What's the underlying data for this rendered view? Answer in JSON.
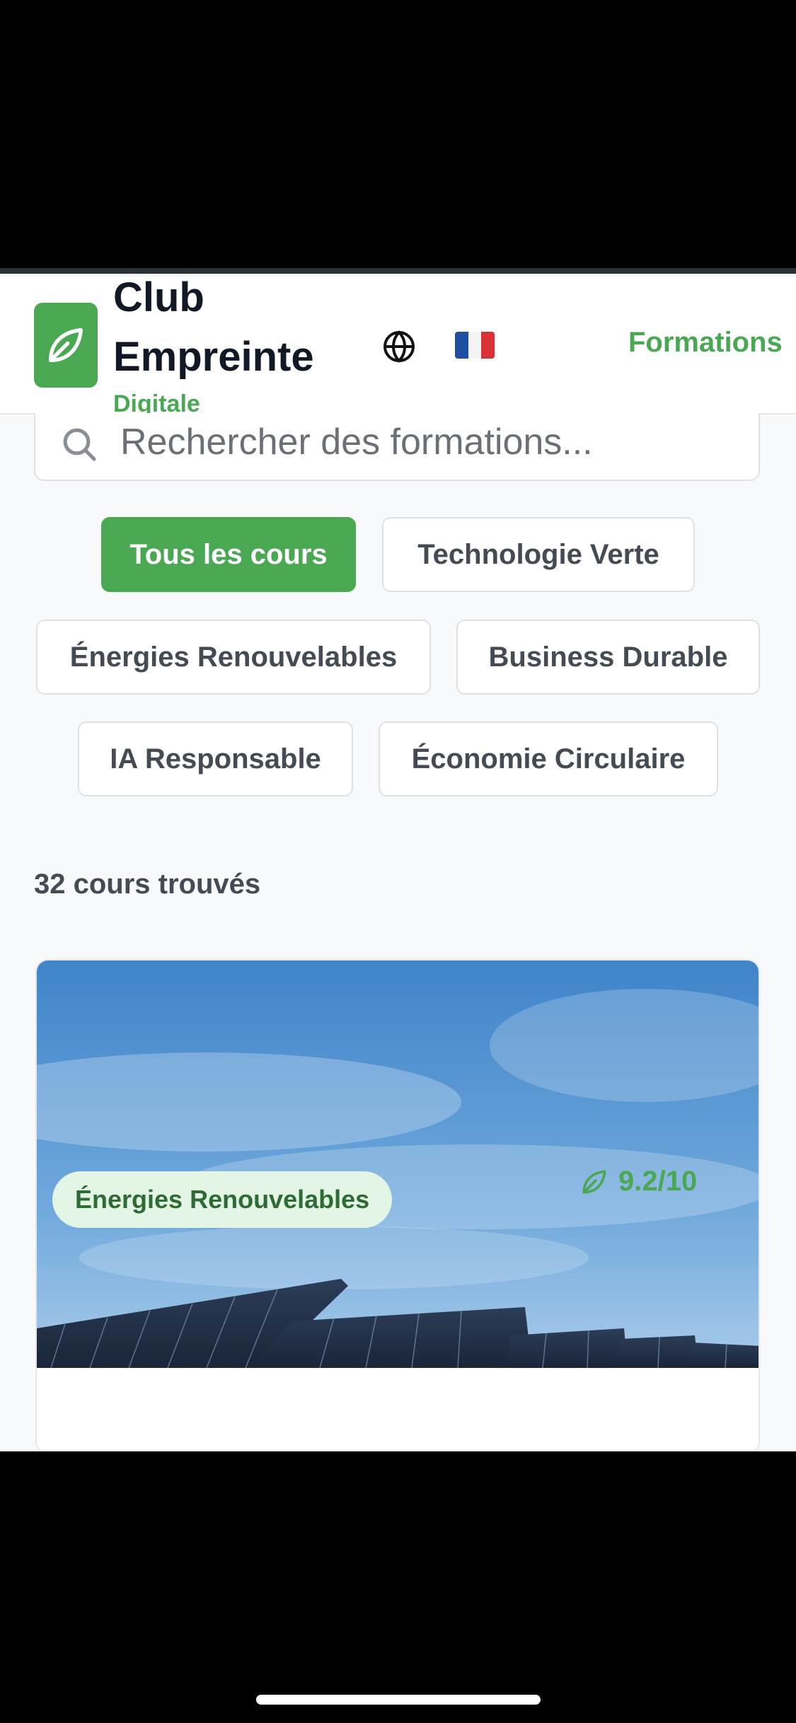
{
  "brand": {
    "line1": "Club",
    "line2": "Empreinte",
    "sub": "Digitale",
    "logo_icon": "leaf-icon",
    "accent": "#4aa853"
  },
  "header": {
    "globe_icon": "globe-icon",
    "flag": "🇫🇷",
    "nav_formations": "Formations"
  },
  "search": {
    "placeholder": "Rechercher des formations...",
    "icon": "search-icon"
  },
  "filters": [
    {
      "label": "Tous les cours",
      "active": true
    },
    {
      "label": "Technologie Verte",
      "active": false
    },
    {
      "label": "Énergies Renouvelables",
      "active": false
    },
    {
      "label": "Business Durable",
      "active": false
    },
    {
      "label": "IA Responsable",
      "active": false
    },
    {
      "label": "Économie Circulaire",
      "active": false
    }
  ],
  "results": {
    "count_text": "32 cours trouvés"
  },
  "course_card": {
    "category": "Énergies Renouvelables",
    "score": "9.2/10",
    "score_icon": "leaf-icon"
  }
}
